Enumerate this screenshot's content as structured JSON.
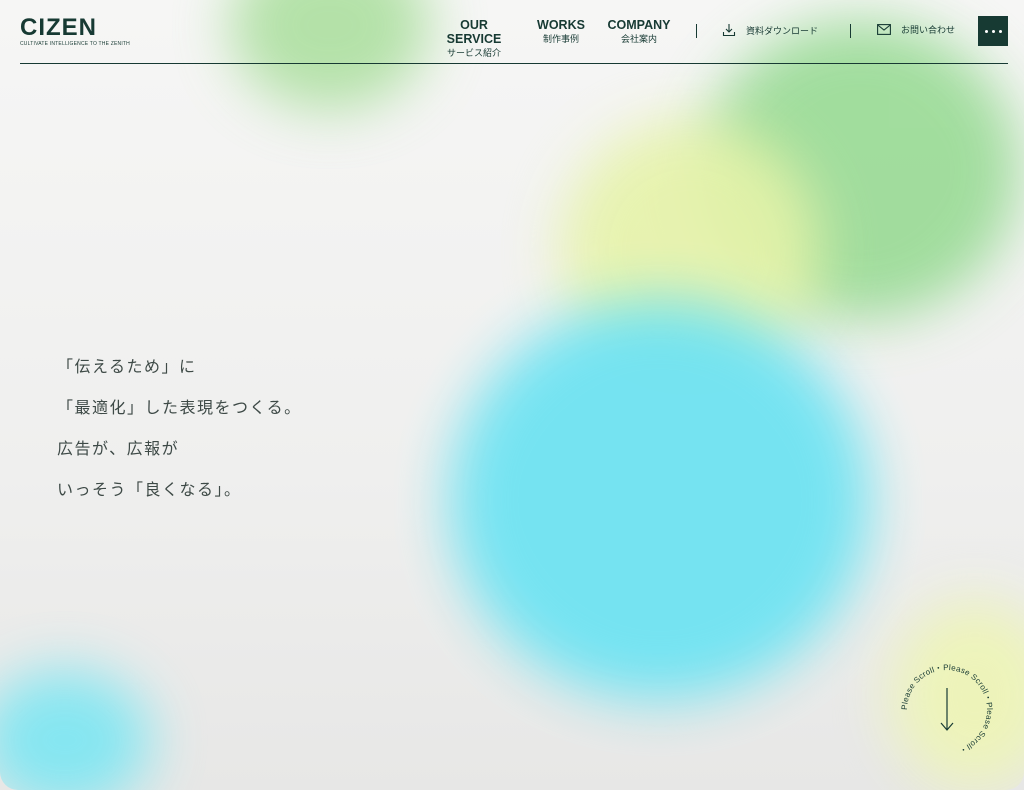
{
  "brand": {
    "name": "CIZEN",
    "tagline": "CULTIVATE INTELLIGENCE TO THE ZENITH"
  },
  "nav": [
    {
      "en": "OUR SERVICE",
      "ja": "サービス紹介"
    },
    {
      "en": "WORKS",
      "ja": "制作事例"
    },
    {
      "en": "COMPANY",
      "ja": "会社案内"
    }
  ],
  "utility": {
    "download": "資料ダウンロード",
    "contact": "お問い合わせ"
  },
  "hero": {
    "lines": [
      "「伝えるため」に",
      "「最適化」した表現をつくる。",
      "広告が、広報が",
      "いっそう「良くなる」。"
    ]
  },
  "scroll": {
    "text": "Please Scroll・Please Scroll・Please Scroll・"
  },
  "colors": {
    "primary": "#173a33",
    "text": "#3e4a47",
    "blob_green": "#93d98f",
    "blob_lime": "#e6f3a9",
    "blob_cyan": "#6fe3f2"
  },
  "icons": {
    "download": "download-icon",
    "contact": "mail-icon",
    "menu": "more-dots-icon",
    "scroll": "arrow-down-icon"
  }
}
